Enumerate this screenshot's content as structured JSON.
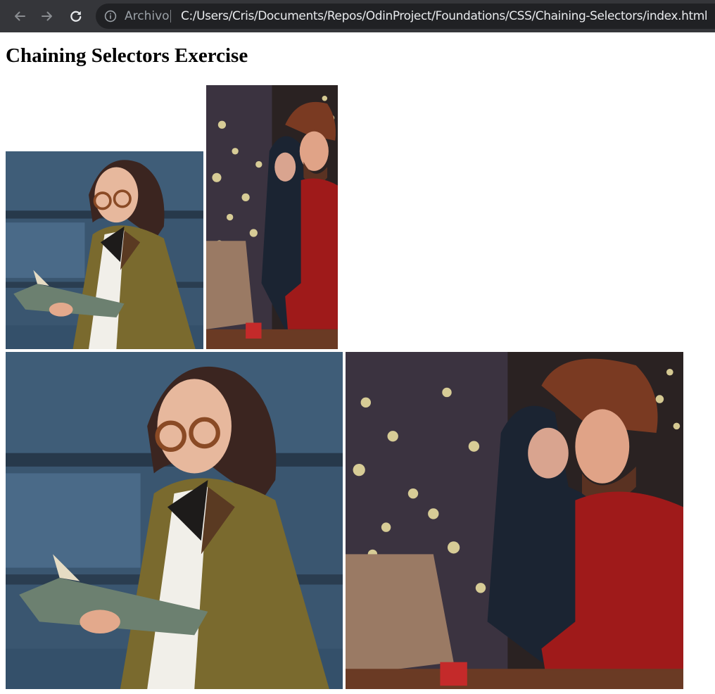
{
  "browser": {
    "scheme_label": "Archivo",
    "url": "C:/Users/Cris/Documents/Repos/OdinProject/Foundations/CSS/Chaining-Selectors/index.html",
    "icons": {
      "back": "arrow-left-icon",
      "forward": "arrow-right-icon",
      "reload": "reload-icon",
      "info": "info-circle-icon"
    },
    "colors": {
      "toolbar": "#35363a",
      "omnibox": "#202124",
      "url_text": "#e8eaed",
      "muted_text": "#9aa0a6"
    }
  },
  "page": {
    "heading": "Chaining Selectors Exercise",
    "images": [
      {
        "subject": "woman-reading-book",
        "display": "small"
      },
      {
        "subject": "couple-with-laptop",
        "display": "small"
      },
      {
        "subject": "woman-reading-book",
        "display": "large"
      },
      {
        "subject": "couple-with-laptop",
        "display": "large"
      }
    ]
  }
}
